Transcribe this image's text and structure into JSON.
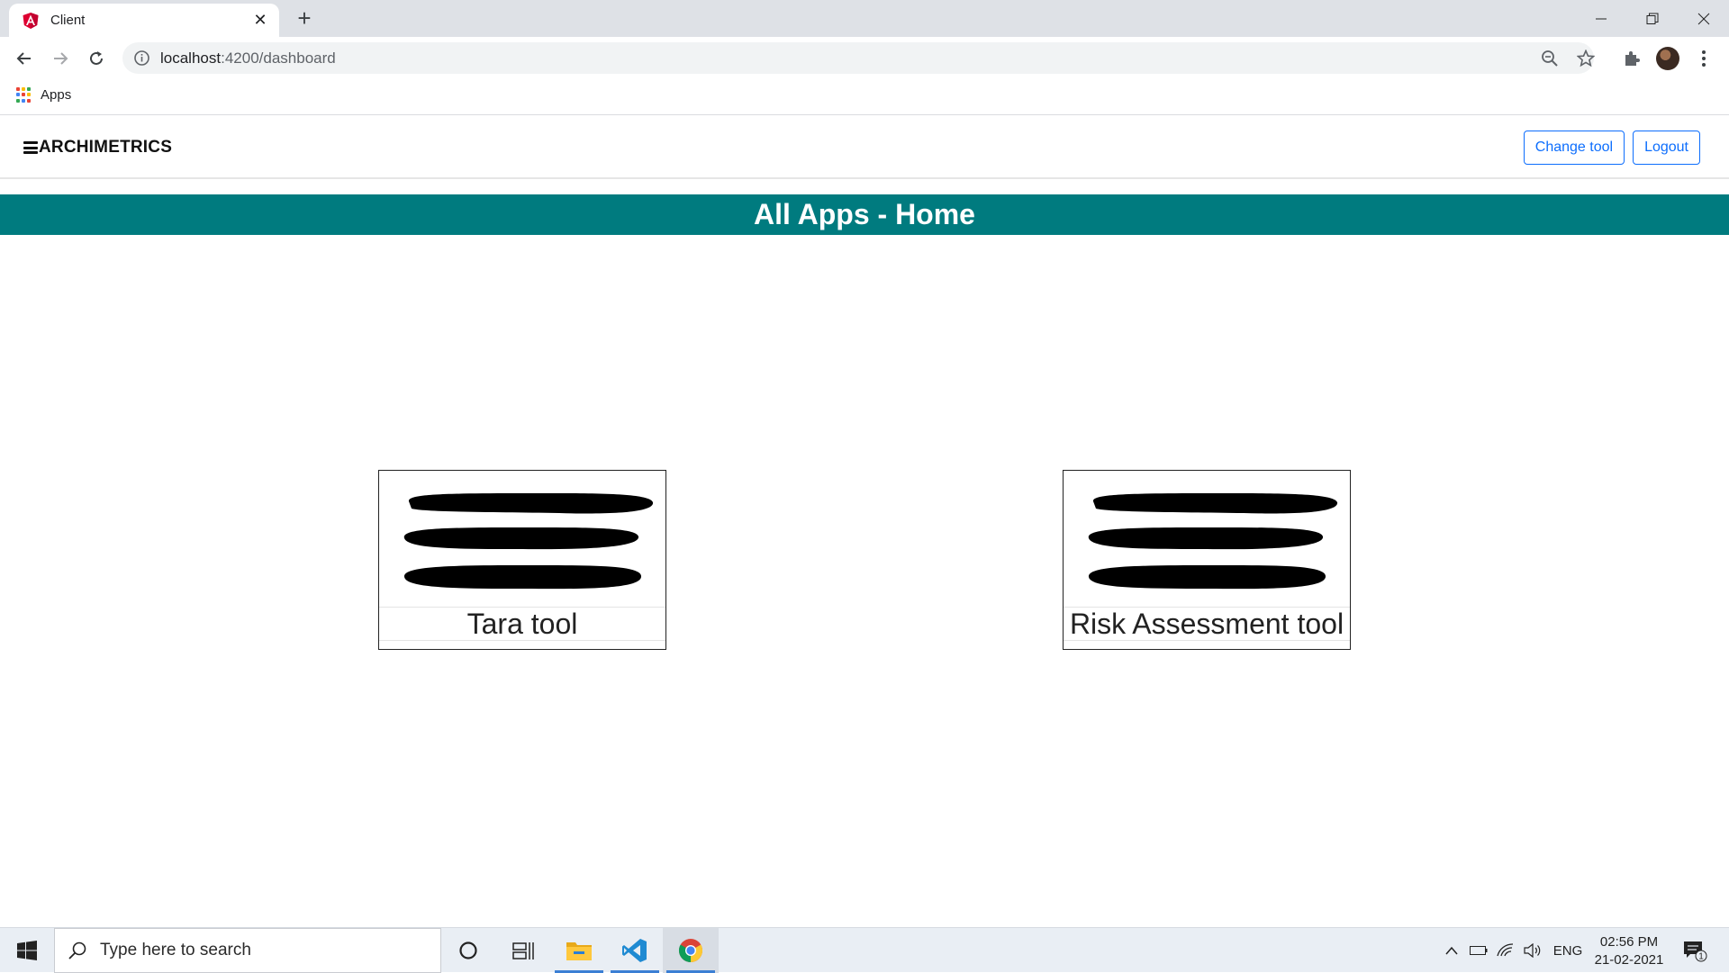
{
  "browser": {
    "tab_title": "Client",
    "url_host": "localhost",
    "url_path": ":4200/dashboard",
    "bookmarks": [
      {
        "label": "Apps"
      }
    ]
  },
  "navbar": {
    "brand": "ARCHIMETRICS",
    "change_tool_label": "Change tool",
    "logout_label": "Logout"
  },
  "page": {
    "heading": "All Apps - Home",
    "banner_color": "#007b7f",
    "apps": [
      {
        "label": "Tara tool",
        "icon": "menu-bars-icon"
      },
      {
        "label": "Risk Assessment tool",
        "icon": "menu-bars-icon"
      }
    ]
  },
  "taskbar": {
    "search_placeholder": "Type here to search",
    "language": "ENG",
    "time": "02:56 PM",
    "date": "21-02-2021",
    "notification_count": "1"
  },
  "colors": {
    "accent_blue": "#0d6efd",
    "teal": "#007b7f"
  }
}
